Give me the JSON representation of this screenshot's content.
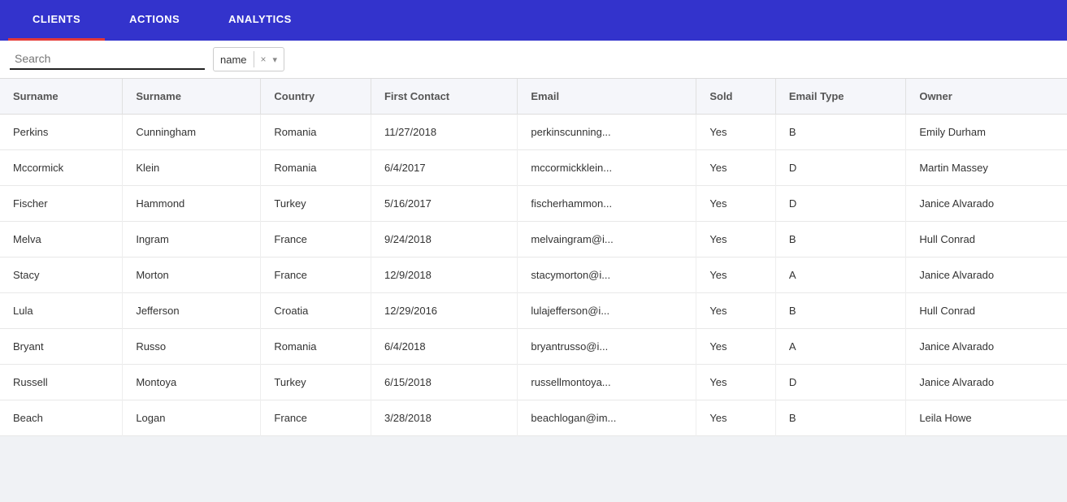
{
  "nav": {
    "tabs": [
      {
        "label": "CLIENTS",
        "active": true
      },
      {
        "label": "ACTIONS",
        "active": false
      },
      {
        "label": "ANALYTICS",
        "active": false
      }
    ]
  },
  "search": {
    "placeholder": "Search",
    "value": ""
  },
  "filter": {
    "value": "name",
    "close_label": "×",
    "chevron_label": "▾"
  },
  "table": {
    "columns": [
      "Surname",
      "Surname",
      "Country",
      "First Contact",
      "Email",
      "Sold",
      "Email Type",
      "Owner"
    ],
    "rows": [
      {
        "col1": "Perkins",
        "col2": "Cunningham",
        "col3": "Romania",
        "col4": "11/27/2018",
        "col5": "perkinscunning...",
        "col6": "Yes",
        "col7": "B",
        "col8": "Emily Durham"
      },
      {
        "col1": "Mccormick",
        "col2": "Klein",
        "col3": "Romania",
        "col4": "6/4/2017",
        "col5": "mccormickklein...",
        "col6": "Yes",
        "col7": "D",
        "col8": "Martin Massey"
      },
      {
        "col1": "Fischer",
        "col2": "Hammond",
        "col3": "Turkey",
        "col4": "5/16/2017",
        "col5": "fischerhammon...",
        "col6": "Yes",
        "col7": "D",
        "col8": "Janice Alvarado"
      },
      {
        "col1": "Melva",
        "col2": "Ingram",
        "col3": "France",
        "col4": "9/24/2018",
        "col5": "melvaingram@i...",
        "col6": "Yes",
        "col7": "B",
        "col8": "Hull Conrad"
      },
      {
        "col1": "Stacy",
        "col2": "Morton",
        "col3": "France",
        "col4": "12/9/2018",
        "col5": "stacymorton@i...",
        "col6": "Yes",
        "col7": "A",
        "col8": "Janice Alvarado"
      },
      {
        "col1": "Lula",
        "col2": "Jefferson",
        "col3": "Croatia",
        "col4": "12/29/2016",
        "col5": "lulajefferson@i...",
        "col6": "Yes",
        "col7": "B",
        "col8": "Hull Conrad"
      },
      {
        "col1": "Bryant",
        "col2": "Russo",
        "col3": "Romania",
        "col4": "6/4/2018",
        "col5": "bryantrusso@i...",
        "col6": "Yes",
        "col7": "A",
        "col8": "Janice Alvarado"
      },
      {
        "col1": "Russell",
        "col2": "Montoya",
        "col3": "Turkey",
        "col4": "6/15/2018",
        "col5": "russellmontoya...",
        "col6": "Yes",
        "col7": "D",
        "col8": "Janice Alvarado"
      },
      {
        "col1": "Beach",
        "col2": "Logan",
        "col3": "France",
        "col4": "3/28/2018",
        "col5": "beachlogan@im...",
        "col6": "Yes",
        "col7": "B",
        "col8": "Leila Howe"
      }
    ]
  }
}
